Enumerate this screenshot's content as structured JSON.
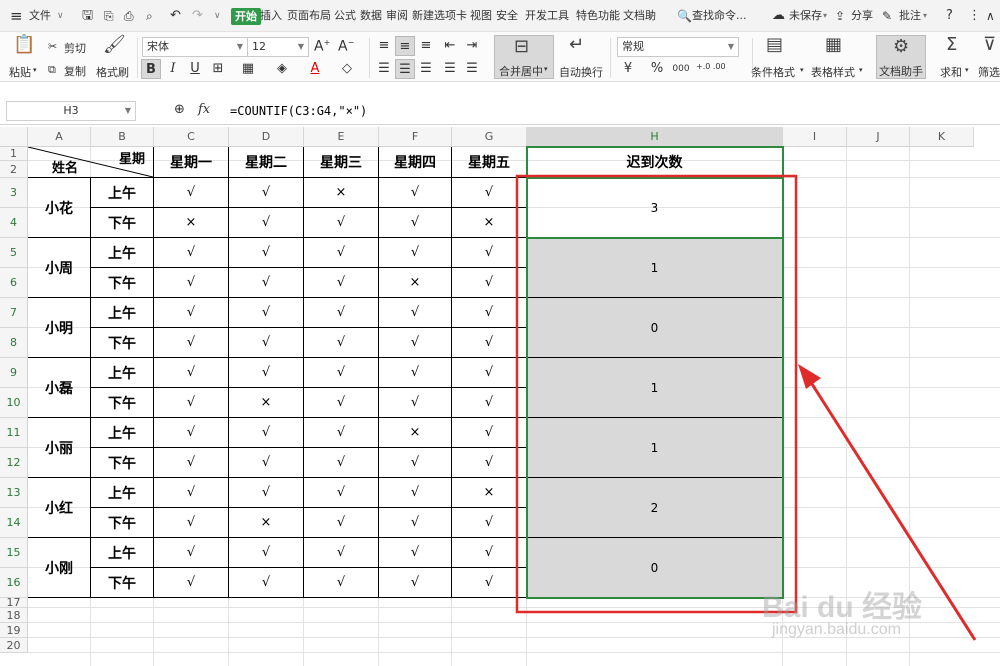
{
  "menu": {
    "file": "文件",
    "tabs": [
      "开始",
      "插入",
      "页面布局",
      "公式",
      "数据",
      "审阅",
      "新建选项卡",
      "视图",
      "安全",
      "开发工具",
      "特色功能",
      "文档助"
    ],
    "search": "查找命令...",
    "unsaved": "未保存",
    "share": "分享",
    "comment": "批注"
  },
  "ribbon": {
    "paste": "粘贴",
    "cut": "剪切",
    "copy": "复制",
    "format_painter": "格式刷",
    "font_name": "宋体",
    "font_size": "12",
    "merge_center": "合并居中",
    "wrap_text": "自动换行",
    "number_format": "常规",
    "conditional_format": "条件格式",
    "table_style": "表格样式",
    "doc_helper": "文档助手",
    "sum": "求和",
    "filter": "筛选",
    "inc_dec": "+.0 .00"
  },
  "formula_bar": {
    "name_box": "H3",
    "fx": "fx",
    "formula": "=COUNTIF(C3:G4,\"×\")"
  },
  "columns": [
    "A",
    "B",
    "C",
    "D",
    "E",
    "F",
    "G",
    "H",
    "I",
    "J",
    "K"
  ],
  "rows": [
    "1",
    "2",
    "3",
    "4",
    "5",
    "6",
    "7",
    "8",
    "9",
    "10",
    "11",
    "12",
    "13",
    "14",
    "15",
    "16",
    "17",
    "18",
    "19",
    "20"
  ],
  "table": {
    "corner_top": "星期",
    "corner_bottom": "姓名",
    "days": [
      "星期一",
      "星期二",
      "星期三",
      "星期四",
      "星期五"
    ],
    "result_header": "迟到次数",
    "am": "上午",
    "pm": "下午",
    "people": [
      {
        "name": "小花",
        "am": [
          "√",
          "√",
          "×",
          "√",
          "√"
        ],
        "pm": [
          "×",
          "√",
          "√",
          "√",
          "×"
        ],
        "count": "3"
      },
      {
        "name": "小周",
        "am": [
          "√",
          "√",
          "√",
          "√",
          "√"
        ],
        "pm": [
          "√",
          "√",
          "√",
          "×",
          "√"
        ],
        "count": "1"
      },
      {
        "name": "小明",
        "am": [
          "√",
          "√",
          "√",
          "√",
          "√"
        ],
        "pm": [
          "√",
          "√",
          "√",
          "√",
          "√"
        ],
        "count": "0"
      },
      {
        "name": "小磊",
        "am": [
          "√",
          "√",
          "√",
          "√",
          "√"
        ],
        "pm": [
          "√",
          "×",
          "√",
          "√",
          "√"
        ],
        "count": "1"
      },
      {
        "name": "小丽",
        "am": [
          "√",
          "√",
          "√",
          "×",
          "√"
        ],
        "pm": [
          "√",
          "√",
          "√",
          "√",
          "√"
        ],
        "count": "1"
      },
      {
        "name": "小红",
        "am": [
          "√",
          "√",
          "√",
          "√",
          "×"
        ],
        "pm": [
          "√",
          "×",
          "√",
          "√",
          "√"
        ],
        "count": "2"
      },
      {
        "name": "小刚",
        "am": [
          "√",
          "√",
          "√",
          "√",
          "√"
        ],
        "pm": [
          "√",
          "√",
          "√",
          "√",
          "√"
        ],
        "count": "0"
      }
    ]
  },
  "watermark": {
    "brand": "Bai du 经验",
    "url": "jingyan.baidu.com"
  },
  "colors": {
    "accent_green": "#2f9a4a",
    "annotation_red": "#e02b2b",
    "selection_gray": "#d9d9d9"
  }
}
